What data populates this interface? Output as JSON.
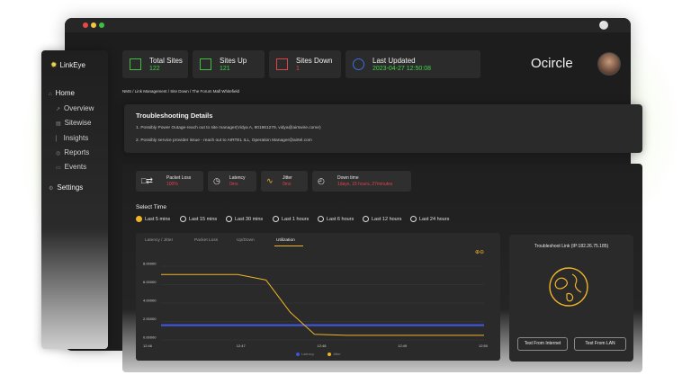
{
  "app": {
    "name": "LinkEye",
    "brand": "Ocircle"
  },
  "colors": {
    "accent": "#f0b429",
    "ok": "#3fd94a",
    "danger": "#e0424a",
    "info": "#3b6fe0",
    "latency_line": "#3c54d8"
  },
  "stats": {
    "total_sites": {
      "label": "Total Sites",
      "value": "122"
    },
    "sites_up": {
      "label": "Sites Up",
      "value": "121"
    },
    "sites_down": {
      "label": "Sites Down",
      "value": "1"
    },
    "last_updated": {
      "label": "Last Updated",
      "value": "2023-04-27 12:50:08"
    }
  },
  "nav": {
    "home": "Home",
    "overview": "Overview",
    "sitewise": "Sitewise",
    "insights": "Insights",
    "reports": "Reports",
    "events": "Events",
    "settings": "Settings"
  },
  "breadcrumb": "NMS / Link Management / Site Down / The Forum Mall Whitefield",
  "troubleshooting": {
    "title": "Troubleshooting Details",
    "items": [
      "1.   Possibly Power Outage-reach out to site manager(Vidya A, 901961279, vidya@airswire.come)",
      "2.   Possibly service provider issue - reach out to AIRTEL ILL, Operation Manager@airtel.com"
    ]
  },
  "metrics": {
    "packet_loss": {
      "label": "Packet Loss",
      "value": "100%"
    },
    "latency": {
      "label": "Latency",
      "value": "0ms"
    },
    "jitter": {
      "label": "Jitter",
      "value": "0ms"
    },
    "down_time": {
      "label": "Down time",
      "value": "1days, 15 hours, 27minutes"
    }
  },
  "select_time": {
    "title": "Select Time",
    "options": [
      "Last 5 mins",
      "Last 15 mins",
      "Last 30 mins",
      "Last 1 hours",
      "Last 6 hours",
      "Last 12 hours",
      "Last 24 hours"
    ],
    "selected": "Last 5 mins"
  },
  "chart_tabs": [
    "Latency / Jitter",
    "Packet Loss",
    "Up/Down",
    "Utilization"
  ],
  "chart_data": {
    "type": "line",
    "x": [
      "12:46",
      "12:47",
      "12:48",
      "12:49",
      "12:50"
    ],
    "ytick_labels": [
      "0.00000",
      "2.00000",
      "4.00000",
      "6.00000",
      "8.00000"
    ],
    "ylim": [
      0,
      8
    ],
    "series": [
      {
        "name": "Latency",
        "color": "#3c54d8",
        "points": [
          [
            0,
            1.6
          ],
          [
            1,
            1.6
          ],
          [
            2,
            1.6
          ],
          [
            3,
            1.6
          ],
          [
            4,
            1.6
          ]
        ]
      },
      {
        "name": "Jitter",
        "color": "#f0b429",
        "points": [
          [
            0,
            7.1
          ],
          [
            0.95,
            7.1
          ],
          [
            1.3,
            6.5
          ],
          [
            1.6,
            3.0
          ],
          [
            1.9,
            0.6
          ],
          [
            2.3,
            0.5
          ],
          [
            4,
            0.5
          ]
        ]
      }
    ]
  },
  "troubleshoot_link": {
    "title": "Troubleshoot Link (IP:182.26.75.185)",
    "test_internet": "Test From Internet",
    "test_lan": "Test From LAN"
  }
}
